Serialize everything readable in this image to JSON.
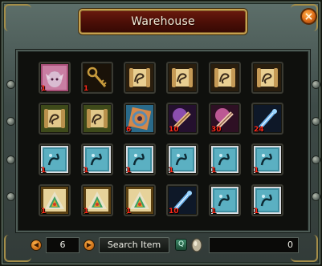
{
  "window": {
    "title": "Warehouse",
    "close_label": "×"
  },
  "colors": {
    "title_plate": "#4a0e06",
    "gold_trim": "#c6a04e",
    "panel": "#3e4b48",
    "quantity_text": "#ff2a1a",
    "button_orange": "#e0701a"
  },
  "slots": [
    {
      "icon": "elf-portrait-icon",
      "qty": "1"
    },
    {
      "icon": "golden-key-icon",
      "qty": "1"
    },
    {
      "icon": "scroll-icon",
      "qty": ""
    },
    {
      "icon": "scroll-icon",
      "qty": ""
    },
    {
      "icon": "scroll-icon",
      "qty": ""
    },
    {
      "icon": "scroll-icon",
      "qty": ""
    },
    {
      "icon": "green-scroll-icon",
      "qty": ""
    },
    {
      "icon": "green-scroll-icon",
      "qty": ""
    },
    {
      "icon": "spiral-gem-icon",
      "qty": "6"
    },
    {
      "icon": "purple-rune-icon",
      "qty": "10"
    },
    {
      "icon": "pink-rune-icon",
      "qty": "30"
    },
    {
      "icon": "blue-potion-icon",
      "qty": "24"
    },
    {
      "icon": "crystal-stone-icon",
      "qty": "1"
    },
    {
      "icon": "crystal-stone-icon",
      "qty": "1"
    },
    {
      "icon": "crystal-stone-icon",
      "qty": "1"
    },
    {
      "icon": "crystal-stone-icon",
      "qty": "1"
    },
    {
      "icon": "crystal-stone-icon",
      "qty": "1"
    },
    {
      "icon": "crystal-stone-icon",
      "qty": "1"
    },
    {
      "icon": "rainbow-gem-icon",
      "qty": "1"
    },
    {
      "icon": "rainbow-gem-icon",
      "qty": "1"
    },
    {
      "icon": "rainbow-gem-icon",
      "qty": "1"
    },
    {
      "icon": "blue-potion-icon",
      "qty": "10"
    },
    {
      "icon": "crystal-stone-icon",
      "qty": "1"
    },
    {
      "icon": "crystal-stone-icon",
      "qty": "1"
    }
  ],
  "footer": {
    "prev_label": "◀",
    "page_number": "6",
    "next_label": "▶",
    "search_label": "Search Item",
    "magnify_label": "Q",
    "money": "0"
  }
}
